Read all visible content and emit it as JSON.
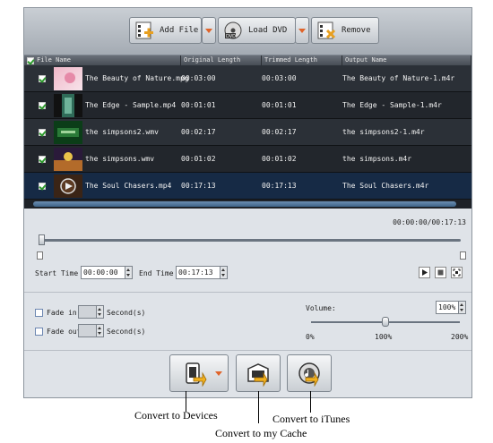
{
  "toolbar": {
    "add_file_label": "Add File",
    "load_dvd_label": "Load DVD",
    "remove_label": "Remove"
  },
  "columns": [
    "File Name",
    "Original Length",
    "Trimmed Length",
    "Output Name"
  ],
  "files": [
    {
      "name": "The Beauty of Nature.mpg",
      "original": "00:03:00",
      "trimmed": "00:03:00",
      "output": "The Beauty of Nature-1.m4r",
      "checked": true
    },
    {
      "name": "The Edge - Sample.mp4",
      "original": "00:01:01",
      "trimmed": "00:01:01",
      "output": "The Edge - Sample-1.m4r",
      "checked": true
    },
    {
      "name": "the simpsons2.wmv",
      "original": "00:02:17",
      "trimmed": "00:02:17",
      "output": "the simpsons2-1.m4r",
      "checked": true
    },
    {
      "name": "the simpsons.wmv",
      "original": "00:01:02",
      "trimmed": "00:01:02",
      "output": "the simpsons.m4r",
      "checked": true
    },
    {
      "name": "The Soul Chasers.mp4",
      "original": "00:17:13",
      "trimmed": "00:17:13",
      "output": "The Soul Chasers.m4r",
      "checked": true
    }
  ],
  "editor": {
    "timecode": "00:00:00/00:17:13",
    "start_time_label": "Start Time",
    "start_time": "00:00:00",
    "end_time_label": "End Time",
    "end_time": "00:17:13"
  },
  "audio": {
    "fade_in_label": "Fade in",
    "fade_out_label": "Fade out",
    "seconds_label": "Second(s)",
    "volume_label": "Volume:",
    "volume_value": "100%",
    "scale_min": "0%",
    "scale_mid": "100%",
    "scale_max": "200%"
  },
  "callouts": {
    "devices": "Convert to Devices",
    "cache": "Convert to my Cache",
    "itunes": "Convert to iTunes"
  },
  "colors": {
    "selected_row": "#162a45",
    "accent": "#e0642a",
    "check": "#2e9a2e"
  }
}
